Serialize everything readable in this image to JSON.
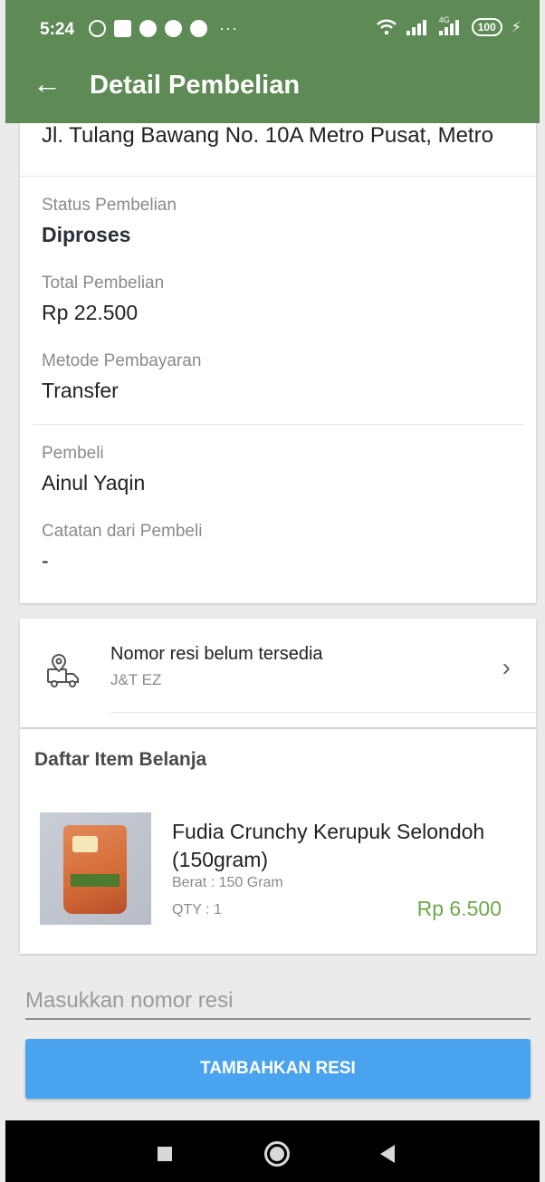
{
  "status_bar": {
    "time": "5:24",
    "more": "···",
    "battery": "100",
    "network": "4G"
  },
  "toolbar": {
    "back_icon": "arrow-left-icon",
    "title": "Detail Pembelian"
  },
  "order": {
    "address": "Jl. Tulang Bawang No. 10A Metro Pusat, Metro",
    "status_label": "Status Pembelian",
    "status_value": "Diproses",
    "total_label": "Total Pembelian",
    "total_value": "Rp 22.500",
    "payment_label": "Metode Pembayaran",
    "payment_value": "Transfer",
    "buyer_label": "Pembeli",
    "buyer_value": "Ainul Yaqin",
    "note_label": "Catatan dari Pembeli",
    "note_value": "-"
  },
  "shipping": {
    "icon": "truck-location-icon",
    "title": "Nomor resi belum tersedia",
    "courier": "J&T EZ",
    "chevron_icon": "chevron-right-icon"
  },
  "items": {
    "title": "Daftar Item Belanja",
    "list": [
      {
        "name": "Fudia Crunchy Kerupuk Selondoh (150gram)",
        "weight": "Berat : 150 Gram",
        "qty": "QTY : 1",
        "price": "Rp 6.500"
      }
    ]
  },
  "resi_form": {
    "placeholder": "Masukkan nomor resi",
    "button_label": "TAMBAHKAN RESI"
  },
  "colors": {
    "appbar": "#5e8a55",
    "button": "#4aa3ee",
    "price": "#6fa84a"
  }
}
